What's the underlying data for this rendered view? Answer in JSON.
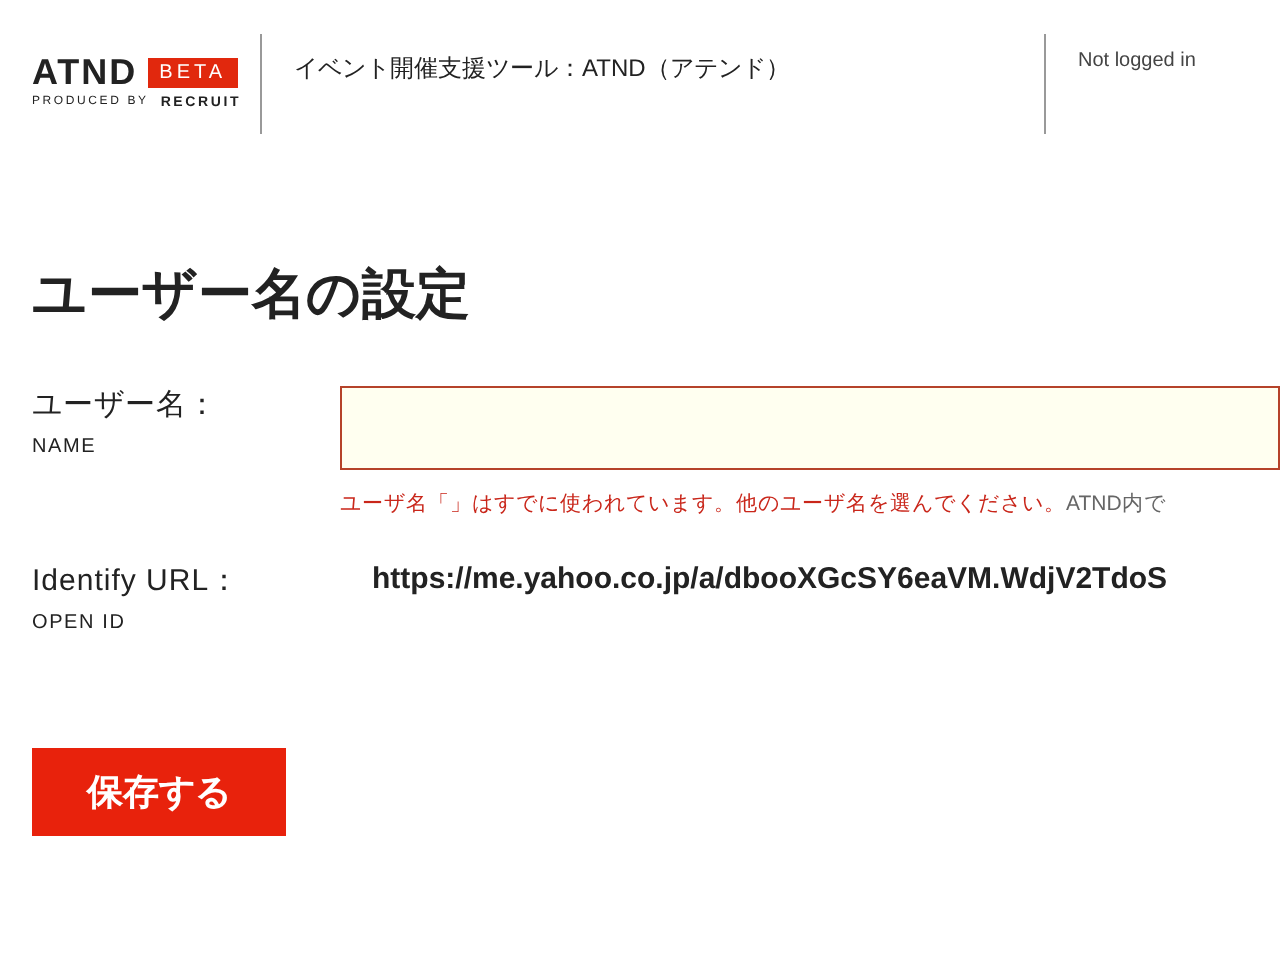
{
  "header": {
    "logo": {
      "name": "ATND",
      "badge": "BETA",
      "tagline": "PRODUCED BY",
      "brand": "RECRUIT"
    },
    "title": "イベント開催支援ツール：ATND（アテンド）",
    "status": "Not logged in"
  },
  "heading": "ユーザー名の設定",
  "fields": [
    {
      "kind": "input",
      "label": "ユーザー名：",
      "sublabel": "NAME",
      "invalid": true,
      "error": "ユーザ名「」はすでに使われています。他のユーザ名を選んでください。",
      "note": "ATND内で"
    },
    {
      "kind": "text",
      "label": "Identify URL：",
      "sublabel": "OPEN ID",
      "value": "https://me.yahoo.co.jp/a/dbooXGcSY6eaVM.WdjV2TdoS"
    }
  ],
  "button": "保存する"
}
